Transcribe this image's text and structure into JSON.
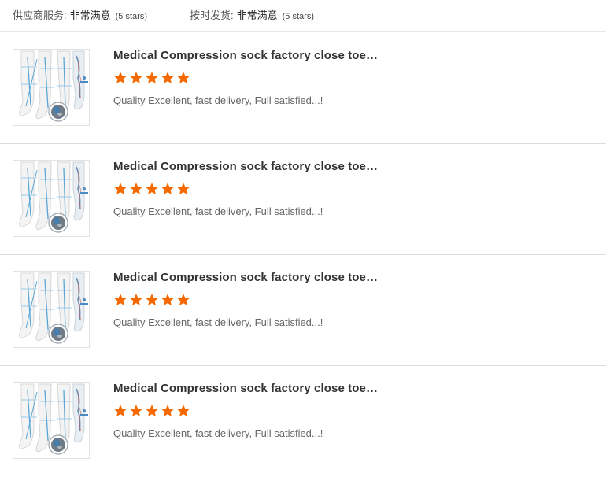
{
  "summary": {
    "supplier_service": {
      "label": "供应商服务:",
      "value": "非常满意",
      "stars": "(5 stars)"
    },
    "on_time_delivery": {
      "label": "按时发货:",
      "value": "非常满意",
      "stars": "(5 stars)"
    }
  },
  "colors": {
    "star": "#f56a00",
    "divider": "#dcdcdc"
  },
  "reviews": [
    {
      "product_title": "Medical Compression sock factory close toe a...",
      "rating": 5,
      "comment": "Quality Excellent, fast delivery, Full satisfied...!",
      "thumbnail_icon": "compression-socks-image"
    },
    {
      "product_title": "Medical Compression sock factory close toe a...",
      "rating": 5,
      "comment": "Quality Excellent, fast delivery, Full satisfied...!",
      "thumbnail_icon": "compression-socks-image"
    },
    {
      "product_title": "Medical Compression sock factory close toe a...",
      "rating": 5,
      "comment": "Quality Excellent, fast delivery, Full satisfied...!",
      "thumbnail_icon": "compression-socks-image"
    },
    {
      "product_title": "Medical Compression sock factory close toe a...",
      "rating": 5,
      "comment": "Quality Excellent, fast delivery, Full satisfied...!",
      "thumbnail_icon": "compression-socks-image"
    }
  ]
}
